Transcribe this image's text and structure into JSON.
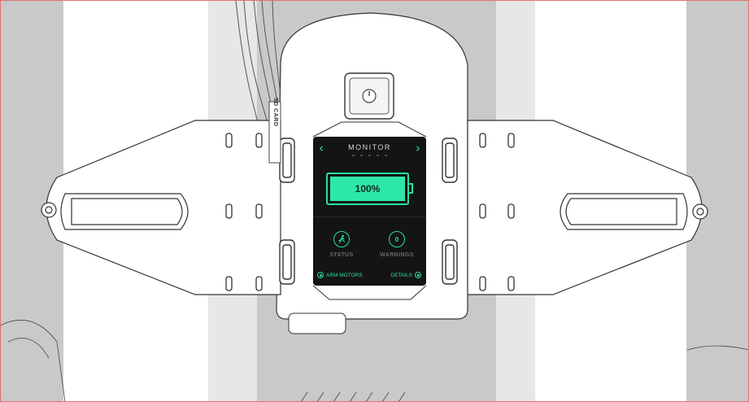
{
  "screen": {
    "title": "MONITOR",
    "nav_prev_icon": "chevron-left-icon",
    "nav_next_icon": "chevron-right-icon",
    "nav_prev_glyph": "‹",
    "nav_next_glyph": "›",
    "page_dots": 5,
    "battery": {
      "level_percent": 100,
      "label": "100%"
    },
    "status": {
      "label": "STATUS",
      "icon": "running-person-icon"
    },
    "warnings": {
      "label": "WARNINGS",
      "count": "0"
    },
    "arm_motors_label": "ARM MOTORS",
    "details_label": "DETAILS"
  },
  "hardware": {
    "sd_card_label": "SD CARD",
    "power_button_icon": "power-icon"
  },
  "colors": {
    "accent": "#28e0a0",
    "screen_bg": "#141414",
    "background": "#c9c9c9",
    "device": "#ffffff"
  }
}
